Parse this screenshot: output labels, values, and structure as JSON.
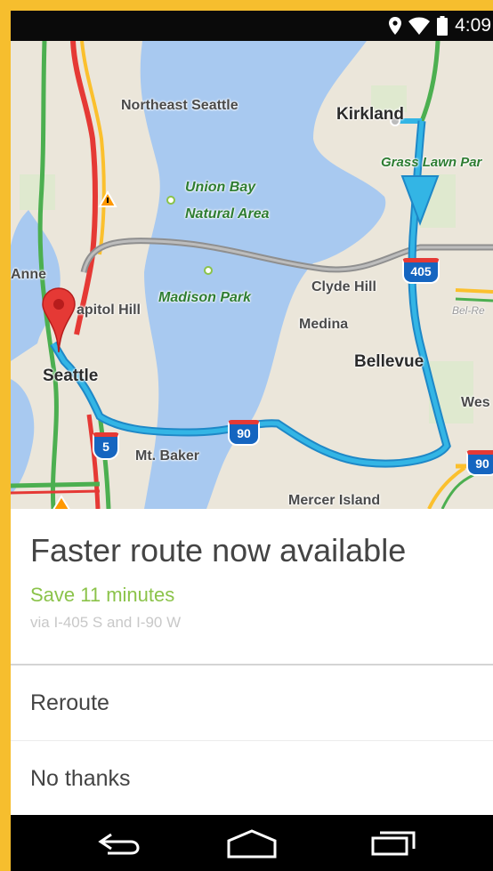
{
  "status_bar": {
    "time": "4:09",
    "icons": [
      "location-pin-icon",
      "wifi-icon",
      "battery-icon"
    ]
  },
  "map": {
    "labels": {
      "northeast_seattle": "Northeast Seattle",
      "kirkland": "Kirkland",
      "grass_lawn": "Grass Lawn Par",
      "union_bay_1": "Union Bay",
      "union_bay_2": "Natural Area",
      "anne": "Anne",
      "capitol_hill": "apitol Hill",
      "madison_park": "Madison Park",
      "clyde_hill": "Clyde Hill",
      "medina": "Medina",
      "bel_red": "Bel-Re",
      "bellevue": "Bellevue",
      "seattle": "Seattle",
      "west": "Wes",
      "mt_baker": "Mt. Baker",
      "mercer_island": "Mercer Island"
    },
    "shields": {
      "i405": "405",
      "i90_mid": "90",
      "i90_right": "90",
      "i5": "5"
    },
    "colors": {
      "water": "#a8c9f0",
      "route": "#33b5e5",
      "alt_route": "#9e9e9e",
      "traffic_green": "#4caf50",
      "traffic_red": "#e53935",
      "traffic_yellow": "#fbc02d",
      "pin": "#e53935"
    }
  },
  "sheet": {
    "title": "Faster route now available",
    "subtitle": "Save 11 minutes",
    "via": "via I-405 S and I-90 W",
    "actions": {
      "reroute": "Reroute",
      "no_thanks": "No thanks"
    }
  },
  "nav_bar": {
    "buttons": [
      "back-icon",
      "home-icon",
      "recent-apps-icon"
    ]
  }
}
